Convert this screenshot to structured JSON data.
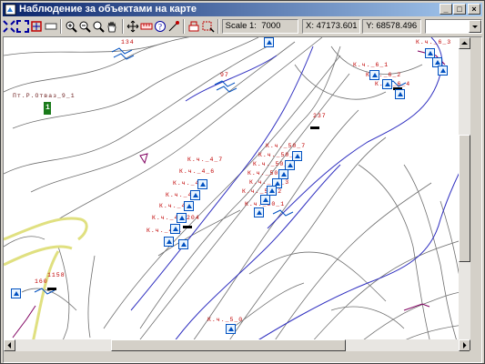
{
  "window": {
    "title": "Наблюдение за объектами на карте"
  },
  "toolbar": {
    "icons": [
      "zoom-extent-icon",
      "zoom-full-icon",
      "zoom-region-icon",
      "zoom-window-icon",
      "zoom-in-icon",
      "zoom-out-icon",
      "zoom-actual-icon",
      "pan-hand-icon",
      "move-icon",
      "measure-icon",
      "info-icon",
      "object-icon",
      "layers-icon",
      "select-icon"
    ],
    "scale_label": "Scale 1:",
    "scale_value": "7000",
    "x_label": "X:",
    "x_value": "47173.601",
    "y_label": "Y:",
    "y_value": "68578.496",
    "combo_value": ""
  },
  "map": {
    "labels": [
      {
        "id": "l1",
        "text": "134"
      },
      {
        "id": "l2",
        "text": "97"
      },
      {
        "id": "l3",
        "text": "Пт.Р.Отваз_9_1"
      },
      {
        "id": "l4",
        "text": "1"
      },
      {
        "id": "l5",
        "text": "К.ч._6_3"
      },
      {
        "id": "l6",
        "text": "К.ч._6_1"
      },
      {
        "id": "l7",
        "text": "К.ч._6_2"
      },
      {
        "id": "l8",
        "text": "К.ч._6_4"
      },
      {
        "id": "l9",
        "text": "К.ч._50_7"
      },
      {
        "id": "l10",
        "text": "К.ч._50_6"
      },
      {
        "id": "l11",
        "text": "К.ч._50_5"
      },
      {
        "id": "l12",
        "text": "К.ч._50_4"
      },
      {
        "id": "l13",
        "text": "К.ч._50_3"
      },
      {
        "id": "l14",
        "text": "К.ч._50_2"
      },
      {
        "id": "l15",
        "text": "К.ч._50_1"
      },
      {
        "id": "l16",
        "text": "К.ч._4_7"
      },
      {
        "id": "l17",
        "text": "К.ч._4_6"
      },
      {
        "id": "l18",
        "text": "К.ч._4_5"
      },
      {
        "id": "l19",
        "text": "К.ч._4_4"
      },
      {
        "id": "l20",
        "text": "К.ч._4_3"
      },
      {
        "id": "l21",
        "text": "К.ч._4_2"
      },
      {
        "id": "l22",
        "text": "К.ч._4_1"
      },
      {
        "id": "l23",
        "text": "237"
      },
      {
        "id": "l24",
        "text": "204"
      },
      {
        "id": "l25",
        "text": "1158"
      },
      {
        "id": "l26",
        "text": "160"
      },
      {
        "id": "l27",
        "text": "К.ч._5_0"
      }
    ]
  }
}
